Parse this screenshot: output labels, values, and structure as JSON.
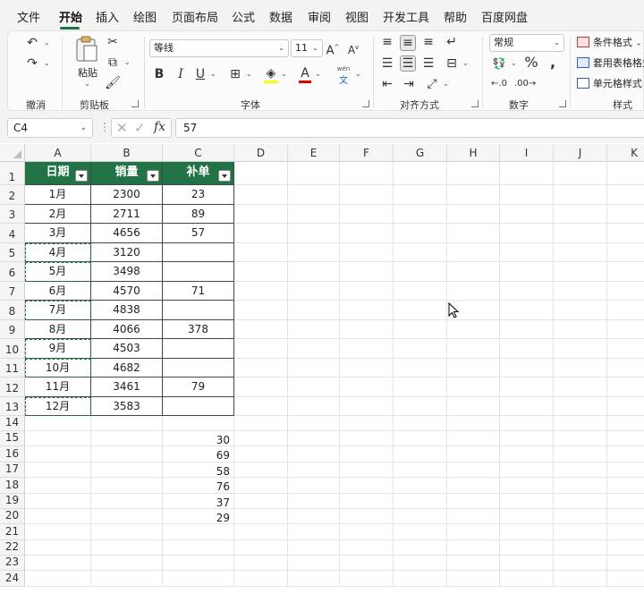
{
  "menu": {
    "items": [
      "文件",
      "开始",
      "插入",
      "绘图",
      "页面布局",
      "公式",
      "数据",
      "审阅",
      "视图",
      "开发工具",
      "帮助",
      "百度网盘"
    ],
    "active_index": 1
  },
  "ribbon": {
    "undo_group_label": "撤消",
    "clipboard_group_label": "剪贴板",
    "paste_label": "粘贴",
    "font_group_label": "字体",
    "font_name": "等线",
    "font_size": "11",
    "align_group_label": "对齐方式",
    "number_group_label": "数字",
    "number_format": "常规",
    "styles_group_label": "样式",
    "conditional_format_label": "条件格式",
    "table_format_label": "套用表格格式",
    "cell_styles_label": "单元格样式",
    "phonetic_top": "wén",
    "phonetic_bottom": "文"
  },
  "formula_bar": {
    "name_box": "C4",
    "fx_label": "fx",
    "formula": "57"
  },
  "sheet": {
    "columns": [
      "A",
      "B",
      "C",
      "D",
      "E",
      "F",
      "G",
      "H",
      "I",
      "J",
      "K"
    ],
    "row_numbers": [
      "1",
      "2",
      "3",
      "4",
      "5",
      "6",
      "7",
      "8",
      "9",
      "10",
      "11",
      "12",
      "13",
      "14",
      "15",
      "16",
      "17",
      "18",
      "19",
      "20",
      "21",
      "22",
      "23",
      "24"
    ],
    "table_headers": [
      "日期",
      "销量",
      "补单"
    ],
    "table_rows": [
      [
        "1月",
        "2300",
        "23"
      ],
      [
        "2月",
        "2711",
        "89"
      ],
      [
        "3月",
        "4656",
        "57"
      ],
      [
        "4月",
        "3120",
        ""
      ],
      [
        "5月",
        "3498",
        ""
      ],
      [
        "6月",
        "4570",
        "71"
      ],
      [
        "7月",
        "4838",
        ""
      ],
      [
        "8月",
        "4066",
        "378"
      ],
      [
        "9月",
        "4503",
        ""
      ],
      [
        "10月",
        "4682",
        ""
      ],
      [
        "11月",
        "3461",
        "79"
      ],
      [
        "12月",
        "3583",
        ""
      ]
    ],
    "extra_c_values": [
      "30",
      "69",
      "58",
      "76",
      "37",
      "29"
    ],
    "header_color": "#217346"
  }
}
